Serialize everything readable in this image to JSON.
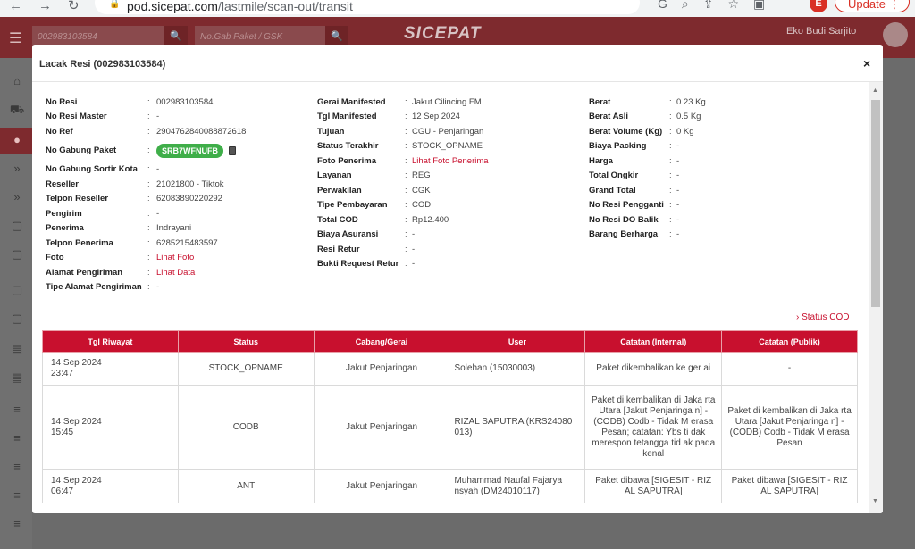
{
  "browser": {
    "url_domain": "pod.sicepat.com",
    "url_path": "/lastmile/scan-out/transit",
    "profile_initial": "E",
    "update_label": "Update"
  },
  "app": {
    "search1_value": "002983103584",
    "search2_placeholder": "No.Gab Paket / GSK",
    "logo": "SICEPAT",
    "user_name": "Eko Budi Sarjito"
  },
  "modal": {
    "title": "Lacak Resi (002983103584)",
    "close_label": "×",
    "status_cod_link": "› Status COD"
  },
  "info": {
    "col1": [
      {
        "label": "No Resi",
        "value": "002983103584"
      },
      {
        "label": "No Resi Master",
        "value": "-"
      },
      {
        "label": "No Ref",
        "value": "290476284008887261​8"
      },
      {
        "label": "No Gabung Paket",
        "value": "SRB7WFNUFB"
      },
      {
        "label": "No Gabung Sortir Kota",
        "value": "-"
      },
      {
        "label": "Reseller",
        "value": "21021800 - Tiktok"
      },
      {
        "label": "Telpon Reseller",
        "value": "62083890220292"
      },
      {
        "label": "Pengirim",
        "value": "-"
      },
      {
        "label": "Penerima",
        "value": "Indrayani"
      },
      {
        "label": "Telpon Penerima",
        "value": "6285215483597"
      },
      {
        "label": "Foto",
        "value": "Lihat Foto"
      },
      {
        "label": "Alamat Pengiriman",
        "value": "Lihat Data"
      },
      {
        "label": "Tipe Alamat Pengiriman",
        "value": "-"
      }
    ],
    "col2": [
      {
        "label": "Gerai Manifested",
        "value": "Jakut Cilincing FM"
      },
      {
        "label": "Tgl Manifested",
        "value": "12 Sep 2024"
      },
      {
        "label": "Tujuan",
        "value": "CGU - Penjaringan"
      },
      {
        "label": "Status Terakhir",
        "value": "STOCK_OPNAME"
      },
      {
        "label": "Foto Penerima",
        "value": "Lihat Foto Penerima"
      },
      {
        "label": "Layanan",
        "value": "REG"
      },
      {
        "label": "Perwakilan",
        "value": "CGK"
      },
      {
        "label": "Tipe Pembayaran",
        "value": "COD"
      },
      {
        "label": "Total COD",
        "value": "Rp12.400"
      },
      {
        "label": "Biaya Asuransi",
        "value": "-"
      },
      {
        "label": "Resi Retur",
        "value": "-"
      },
      {
        "label": "Bukti Request Retur",
        "value": "-"
      }
    ],
    "col3": [
      {
        "label": "Berat",
        "value": "0.23 Kg"
      },
      {
        "label": "Berat Asli",
        "value": "0.5 Kg"
      },
      {
        "label": "Berat Volume (Kg)",
        "value": "0 Kg"
      },
      {
        "label": "Biaya Packing",
        "value": "-"
      },
      {
        "label": "Harga",
        "value": "-"
      },
      {
        "label": "Total Ongkir",
        "value": "-"
      },
      {
        "label": "Grand Total",
        "value": "-"
      },
      {
        "label": "No Resi Pengganti",
        "value": "-"
      },
      {
        "label": "No Resi DO Balik",
        "value": "-"
      },
      {
        "label": "Barang Berharga",
        "value": "-"
      }
    ]
  },
  "table": {
    "headers": [
      "Tgl Riwayat",
      "Status",
      "Cabang/Gerai",
      "User",
      "Catatan (Internal)",
      "Catatan (Publik)"
    ],
    "rows": [
      {
        "date": "14 Sep 2024",
        "time": "23:47",
        "status": "STOCK_OPNAME",
        "cabang": "Jakut Penjaringan",
        "user": "Solehan (15030003)",
        "internal": "Paket dikembalikan ke ger ai",
        "publik": "-"
      },
      {
        "date": "14 Sep 2024",
        "time": "15:45",
        "status": "CODB",
        "cabang": "Jakut Penjaringan",
        "user": "RIZAL SAPUTRA (KRS24080 013)",
        "internal": "Paket di kembalikan di Jaka rta Utara [Jakut Penjaringa n] - (CODB) Codb - Tidak M erasa Pesan; catatan: Ybs ti dak merespon tetangga tid ak pada kenal",
        "publik": "Paket di kembalikan di Jaka rta Utara [Jakut Penjaringa n] - (CODB) Codb - Tidak M erasa Pesan"
      },
      {
        "date": "14 Sep 2024",
        "time": "06:47",
        "status": "ANT",
        "cabang": "Jakut Penjaringan",
        "user": "Muhammad Naufal Fajarya nsyah (DM24010117)",
        "internal": "Paket dibawa [SIGESIT - RIZ AL SAPUTRA]",
        "publik": "Paket dibawa [SIGESIT - RIZ AL SAPUTRA]"
      }
    ]
  }
}
